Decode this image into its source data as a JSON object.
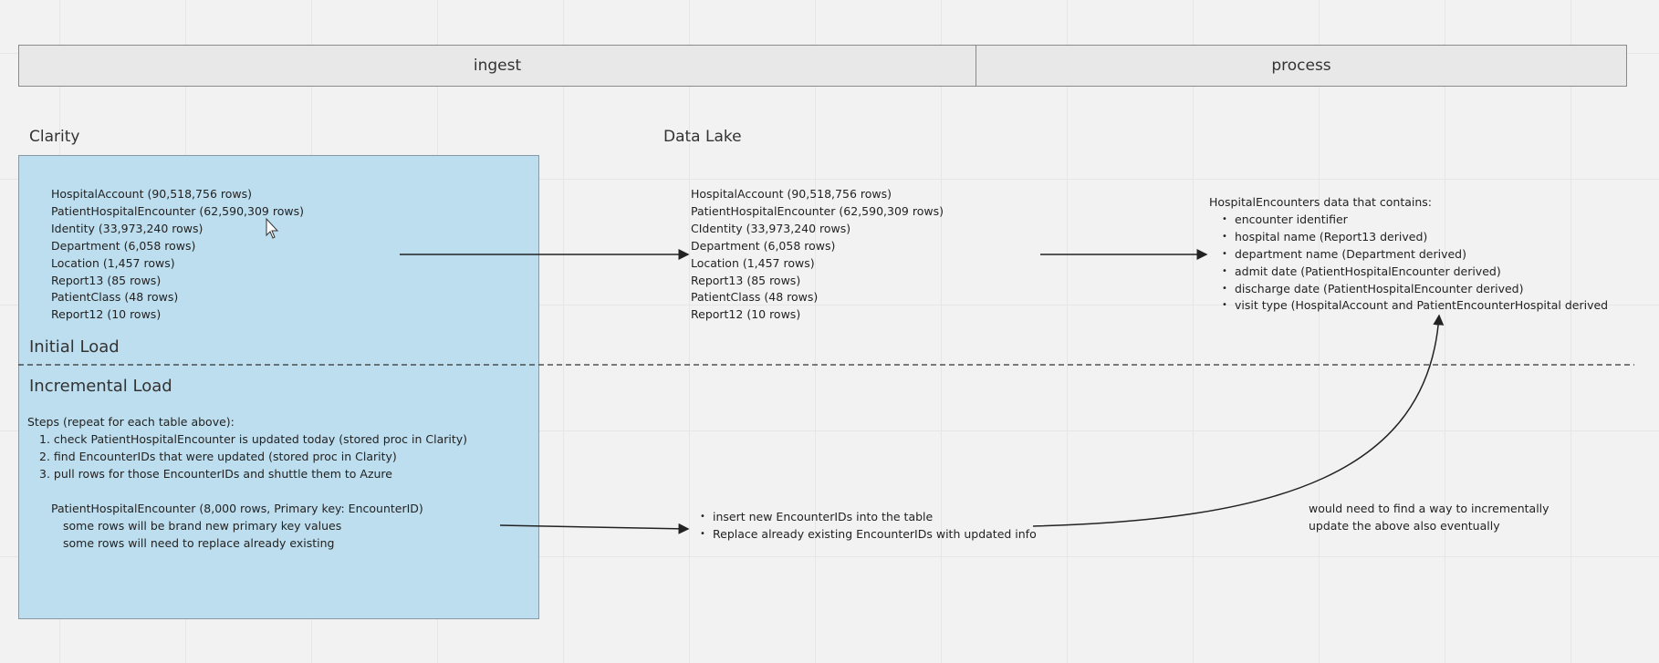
{
  "lanes": {
    "ingest": "ingest",
    "process": "process"
  },
  "clarity": {
    "title": "Clarity",
    "tables": [
      "HospitalAccount (90,518,756 rows)",
      "PatientHospitalEncounter (62,590,309 rows)",
      "Identity (33,973,240 rows)",
      "Department (6,058 rows)",
      "Location (1,457 rows)",
      "Report13 (85 rows)",
      "PatientClass (48 rows)",
      "Report12 (10 rows)"
    ],
    "initial_load": "Initial Load",
    "incremental_load": "Incremental Load",
    "steps_title": "Steps (repeat for each table above):",
    "steps": [
      "1. check PatientHospitalEncounter is updated today (stored proc in Clarity)",
      "2. find EncounterIDs that were updated (stored proc in Clarity)",
      "3. pull rows for those EncounterIDs and shuttle them to Azure"
    ],
    "incremental_table": "PatientHospitalEncounter (8,000 rows, Primary key: EncounterID)",
    "incremental_notes": [
      "some rows will be brand new primary key values",
      "some rows will need to replace already existing"
    ]
  },
  "data_lake": {
    "title": "Data Lake",
    "tables": [
      "HospitalAccount (90,518,756 rows)",
      "PatientHospitalEncounter (62,590,309 rows)",
      "CIdentity (33,973,240 rows)",
      "Department (6,058 rows)",
      "Location (1,457 rows)",
      "Report13 (85 rows)",
      "PatientClass (48 rows)",
      "Report12 (10 rows)"
    ],
    "incremental_actions": [
      "insert new EncounterIDs into the table",
      "Replace already existing EncounterIDs with updated info"
    ]
  },
  "process": {
    "title": "HospitalEncounters data that contains:",
    "fields": [
      "encounter identifier",
      "hospital name (Report13 derived)",
      "department name (Department derived)",
      "admit date (PatientHospitalEncounter derived)",
      "discharge date (PatientHospitalEncounter derived)",
      "visit type (HospitalAccount and PatientEncounterHospital derived"
    ],
    "note": [
      "would need to find a way to incrementally",
      "update the above also eventually"
    ]
  }
}
